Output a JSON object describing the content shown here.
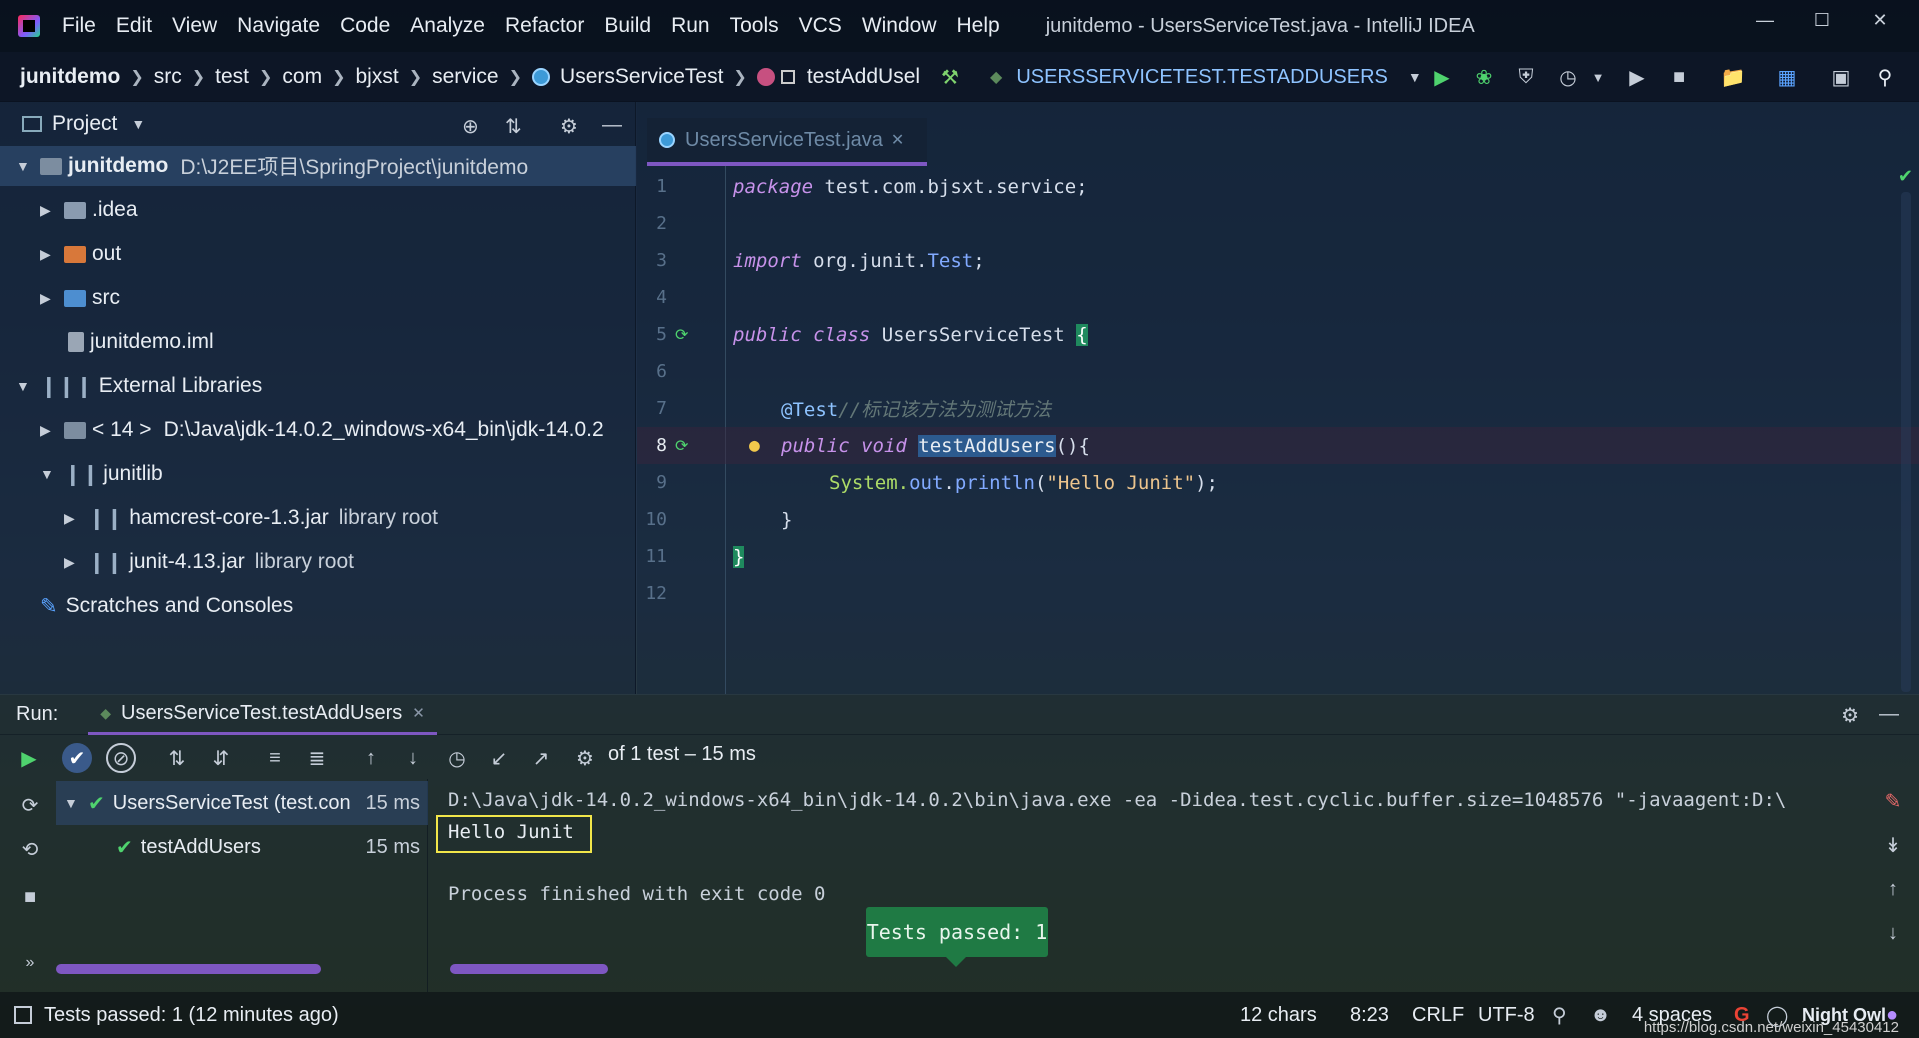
{
  "menubar": {
    "items": [
      "File",
      "Edit",
      "View",
      "Navigate",
      "Code",
      "Analyze",
      "Refactor",
      "Build",
      "Run",
      "Tools",
      "VCS",
      "Window",
      "Help"
    ],
    "window_title": "junitdemo - UsersServiceTest.java - IntelliJ IDEA"
  },
  "navbar": {
    "crumbs": [
      "junitdemo",
      "src",
      "test",
      "com",
      "bjxst",
      "service",
      "UsersServiceTest",
      "testAddUsel"
    ],
    "run_config": "USERSSERVICETEST.TESTADDUSERS"
  },
  "project": {
    "title": "Project",
    "root_name": "junitdemo",
    "root_path": "D:\\J2EE项目\\SpringProject\\junitdemo",
    "idea": ".idea",
    "out": "out",
    "src": "src",
    "iml": "junitdemo.iml",
    "external_libraries": "External Libraries",
    "jdk_label": "< 14 >",
    "jdk_path": "D:\\Java\\jdk-14.0.2_windows-x64_bin\\jdk-14.0.2",
    "junitlib": "junitlib",
    "hamcrest": "hamcrest-core-1.3.jar",
    "junit_jar": "junit-4.13.jar",
    "library_root": "library root",
    "scratches": "Scratches and Consoles"
  },
  "editor": {
    "tab_label": "UsersServiceTest.java",
    "lines": {
      "n1": "1",
      "n2": "2",
      "n3": "3",
      "n4": "4",
      "n5": "5",
      "n6": "6",
      "n7": "7",
      "n8": "8",
      "n9": "9",
      "n10": "10",
      "n11": "11",
      "n12": "12"
    },
    "code": {
      "kw_package": "package",
      "pkg_name": " test.com.bjsxt.service;",
      "kw_import": "import",
      "import_pkg": " org.junit.",
      "import_cls": "Test",
      "import_end": ";",
      "kw_public": "public",
      "kw_class": " class",
      "class_name": " UsersServiceTest ",
      "brace_open": "{",
      "annotation": "@Test",
      "comment": "//标记该方法为测试方法",
      "kw_void": " void ",
      "method_name": "testAddUsers",
      "method_parens": "(){",
      "sys_prefix": "System.",
      "sys_out": "out",
      "sys_dot": ".",
      "sys_println": "println",
      "paren_open": "(",
      "str_val": "\"Hello Junit\"",
      "paren_close": ");",
      "brace_close_inner": "}",
      "brace_close_outer": "}"
    }
  },
  "run": {
    "label": "Run:",
    "tab_label": "UsersServiceTest.testAddUsers",
    "summary": "of 1 test – 15 ms",
    "tree": {
      "suite_label": "UsersServiceTest (test.con",
      "suite_time": "15 ms",
      "test_label": "testAddUsers",
      "test_time": "15 ms"
    },
    "console": {
      "cmd": "D:\\Java\\jdk-14.0.2_windows-x64_bin\\jdk-14.0.2\\bin\\java.exe -ea -Didea.test.cyclic.buffer.size=1048576 \"-javaagent:D:\\",
      "output": "Hello Junit",
      "exit": "Process finished with exit code 0"
    },
    "tooltip": "Tests passed: 1"
  },
  "statusbar": {
    "message": "Tests passed: 1 (12 minutes ago)",
    "chars": "12 chars",
    "position": "8:23",
    "line_sep": "CRLF",
    "encoding": "UTF-8",
    "indent": "4 spaces",
    "theme": "Night Owl",
    "watermark": "https://blog.csdn.net/weixin_45430412"
  },
  "colors": {
    "accent": "#7e57c2",
    "pass_green": "#4fd36e",
    "highlight_box": "#f2e64a"
  }
}
